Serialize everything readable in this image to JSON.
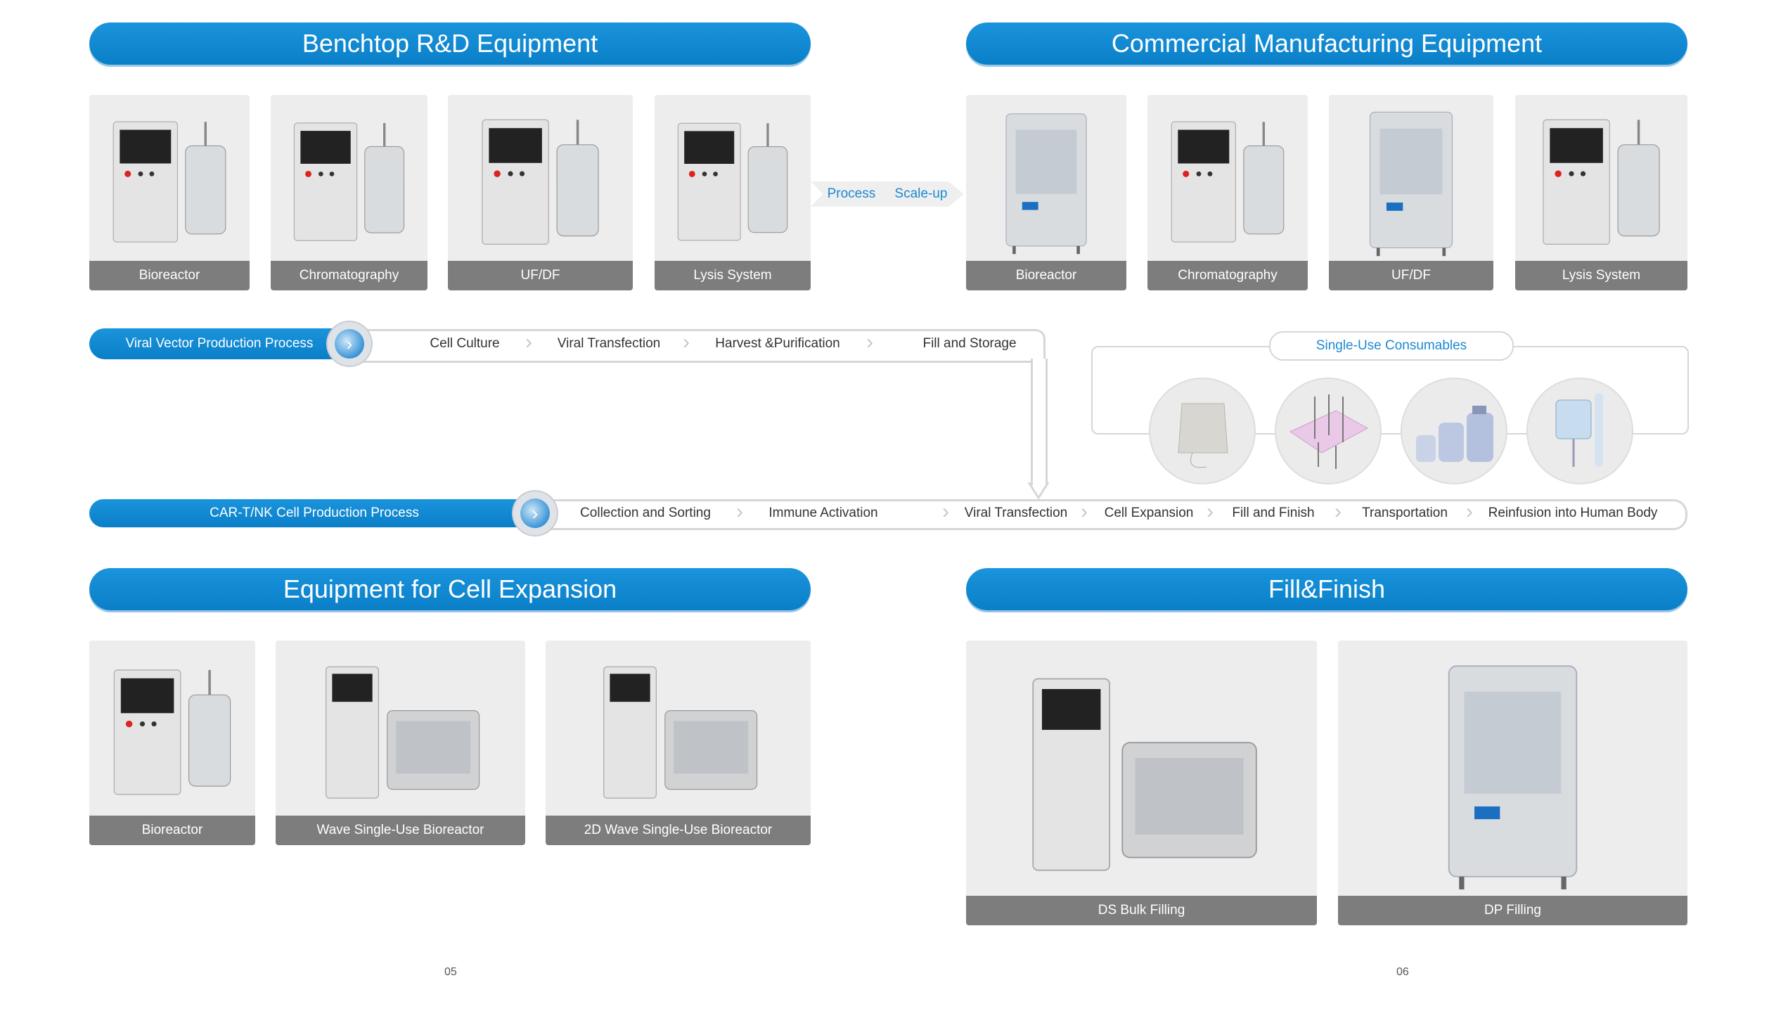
{
  "sections": {
    "benchtop": {
      "title": "Benchtop R&D Equipment",
      "items": [
        "Bioreactor",
        "Chromatography",
        "UF/DF",
        "Lysis System"
      ]
    },
    "commercial": {
      "title": "Commercial Manufacturing Equipment",
      "items": [
        "Bioreactor",
        "Chromatography",
        "UF/DF",
        "Lysis System"
      ]
    },
    "cell_expansion": {
      "title": "Equipment for Cell Expansion",
      "items": [
        "Bioreactor",
        "Wave Single-Use Bioreactor",
        "2D Wave Single-Use Bioreactor"
      ]
    },
    "fill_finish": {
      "title": "Fill&Finish",
      "items": [
        "DS Bulk Filling",
        "DP Filling"
      ]
    }
  },
  "scaleup": {
    "left": "Process",
    "right": "Scale-up"
  },
  "viral_vector": {
    "title": "Viral Vector Production Process",
    "steps": [
      "Cell Culture",
      "Viral Transfection",
      "Harvest &Purification",
      "Fill and Storage"
    ]
  },
  "consumables": {
    "title": "Single-Use Consumables"
  },
  "cart": {
    "title": "CAR-T/NK Cell Production Process",
    "steps": [
      "Collection and Sorting",
      "Immune Activation",
      "Viral Transfection",
      "Cell Expansion",
      "Fill and Finish",
      "Transportation",
      "Reinfusion into Human Body"
    ]
  },
  "pages": {
    "left": "05",
    "right": "06"
  },
  "colors": {
    "accent": "#0a84cf",
    "label_bg": "#7d7d7d",
    "card_bg": "#ededed"
  }
}
